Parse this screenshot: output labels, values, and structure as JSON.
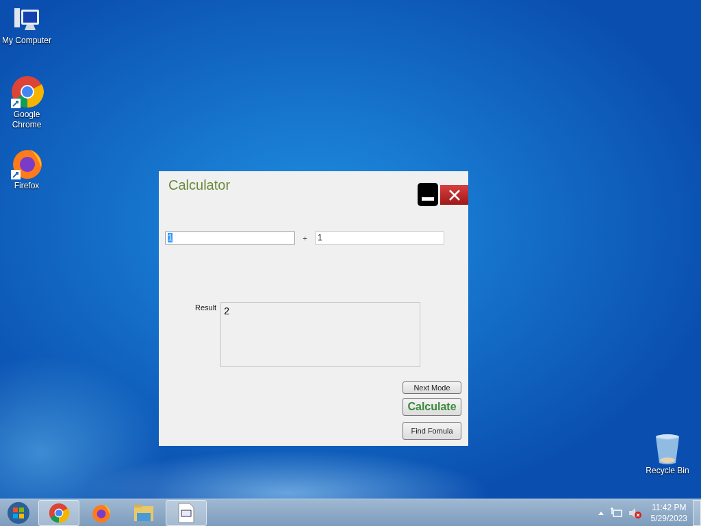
{
  "desktop_icons": [
    {
      "kind": "computer",
      "label": "My Computer"
    },
    {
      "kind": "chrome",
      "label": "Google Chrome"
    },
    {
      "kind": "firefox",
      "label": "Firefox"
    },
    {
      "kind": "recycle",
      "label": "Recycle Bin"
    }
  ],
  "window": {
    "title": "Calculator",
    "operand_1": {
      "value": "1",
      "text_selected": true
    },
    "operator": "+",
    "operand_2": {
      "value": "1",
      "text_selected": false
    },
    "result_label": "Result",
    "result": "2",
    "buttons": [
      {
        "kind": "normal",
        "label": "Next Mode"
      },
      {
        "kind": "primary",
        "label": "Calculate"
      },
      {
        "kind": "tall",
        "label": "Find Fomula"
      }
    ]
  },
  "taskbar": {
    "items": [
      {
        "kind": "chrome",
        "running": true
      },
      {
        "kind": "firefox",
        "running": false
      },
      {
        "kind": "folder",
        "running": false
      },
      {
        "kind": "app",
        "running": true
      }
    ],
    "time": "11:42 PM",
    "date": "5/29/2023"
  }
}
